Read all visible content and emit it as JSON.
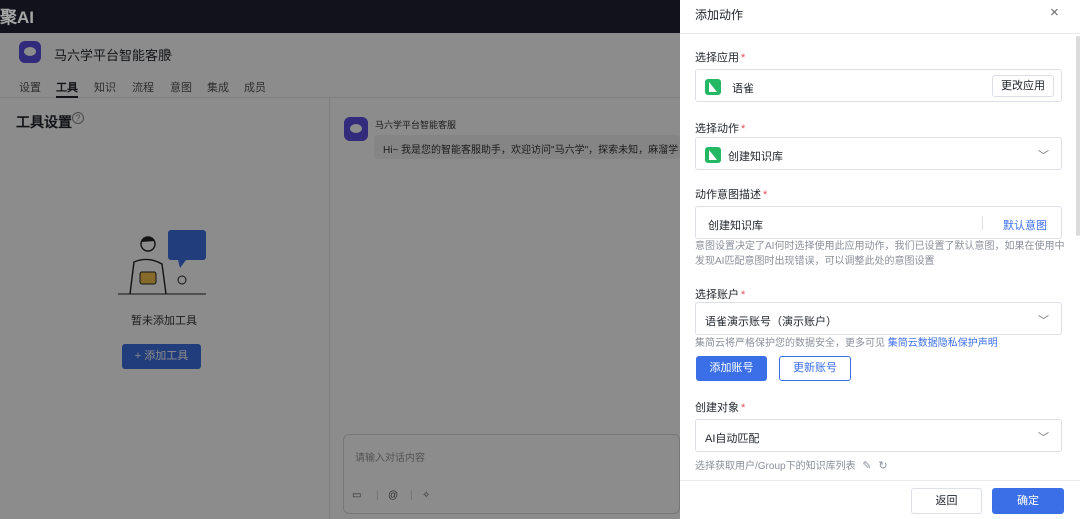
{
  "topbar": {
    "brand": "聚AI"
  },
  "app": {
    "bot_name": "马六学平台智能客服",
    "tabs": [
      "设置",
      "工具",
      "知识",
      "流程",
      "意图",
      "集成",
      "成员"
    ],
    "active_tab": "工具"
  },
  "tools_panel": {
    "title": "工具设置",
    "empty_text": "暂未添加工具",
    "add_button": "+ 添加工具"
  },
  "chat": {
    "sender": "马六学平台智能客服",
    "message": "Hi~ 我是您的智能客服助手，欢迎访问\"马六学\"，探索未知，麻溜学",
    "input_placeholder": "请输入对话内容"
  },
  "drawer": {
    "title": "添加动作",
    "close_glyph": "×",
    "app_label": "选择应用",
    "app_value": "语雀",
    "change_app_button": "更改应用",
    "action_label": "选择动作",
    "action_value": "创建知识库",
    "intent_label": "动作意图描述",
    "intent_value": "创建知识库",
    "default_intent_link": "默认意图",
    "intent_hint": "意图设置决定了AI何时选择使用此应用动作，我们已设置了默认意图，如果在使用中发现AI匹配意图时出现错误，可以调整此处的意图设置",
    "account_label": "选择账户",
    "account_value": "语雀演示账号（演示账户）",
    "privacy_hint": "集简云将严格保护您的数据安全，更多可见",
    "privacy_link": "集简云数据隐私保护声明",
    "add_account_button": "添加账号",
    "refresh_account_button": "更新账号",
    "object_label": "创建对象",
    "object_value": "AI自动匹配",
    "object_hint": "选择获取用户/Group下的知识库列表",
    "back_button": "返回",
    "confirm_button": "确定"
  },
  "colors": {
    "primary": "#3b6fe8",
    "required": "#e34d59",
    "brand_purple": "#5b4fe0",
    "yuque_green": "#25b864",
    "topbar": "#1b1d2b"
  }
}
